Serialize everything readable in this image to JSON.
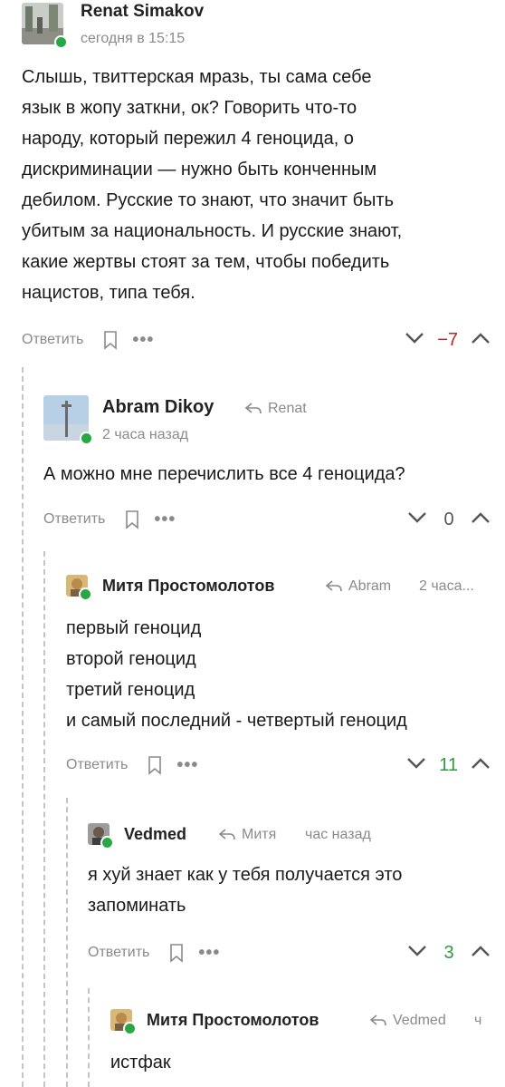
{
  "colors": {
    "negative": "#b8242a",
    "positive": "#2d9a3e",
    "muted": "#8a8a8a",
    "online": "#27a844"
  },
  "comments": [
    {
      "author": "Renat Simakov",
      "time": "сегодня в 15:15",
      "text": "Слышь, твиттерская мразь, ты сама себе\nязык в жопу заткни, ок? Говорить что-то\nнароду, который пережил 4 геноцида, о\nдискриминации — нужно быть конченным\nдебилом. Русские то знают, что значит быть\nубитым за национальность. И русские знают,\nкакие жертвы стоят за тем, чтобы победить\nнацистов, типа тебя.",
      "reply_label": "Ответить",
      "more": "•••",
      "score": "−7"
    },
    {
      "author": "Abram Dikoy",
      "reply_to": "Renat",
      "time": "2 часа назад",
      "text": "А можно мне перечислить все 4 геноцида?",
      "reply_label": "Ответить",
      "more": "•••",
      "score": "0"
    },
    {
      "author": "Митя Простомолотов",
      "reply_to": "Abram",
      "time": "2 часа...",
      "text": "первый геноцид\nвторой геноцид\nтретий геноцид\nи самый последний - четвертый геноцид",
      "reply_label": "Ответить",
      "more": "•••",
      "score": "11"
    },
    {
      "author": "Vedmed",
      "reply_to": "Митя",
      "time": "час назад",
      "text": "я хуй знает как у тебя получается это\nзапоминать",
      "reply_label": "Ответить",
      "more": "•••",
      "score": "3"
    },
    {
      "author": "Митя Простомолотов",
      "reply_to": "Vedmed",
      "time": "ч",
      "text": "истфак"
    }
  ]
}
